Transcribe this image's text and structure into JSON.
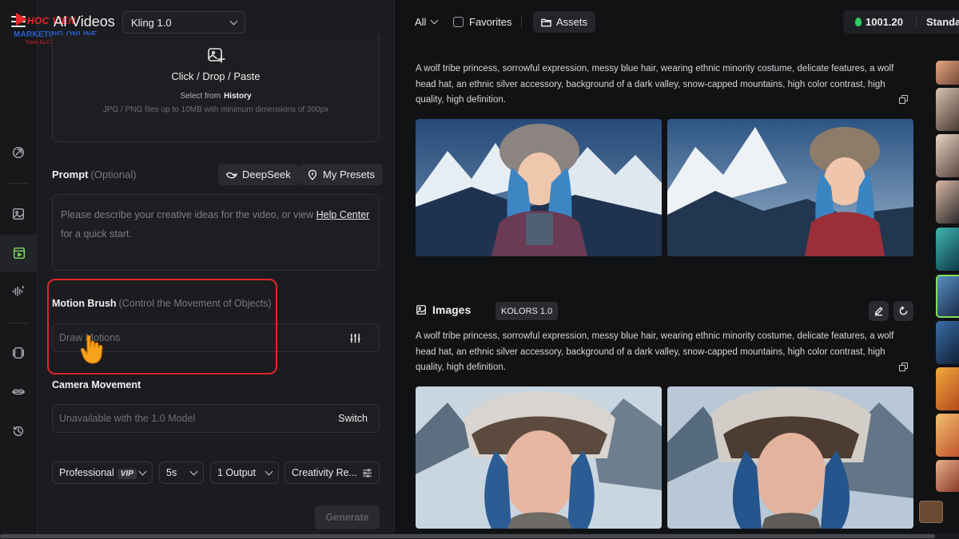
{
  "logo": {
    "line1": "HOC VIEN",
    "line2": "MARKETING ONLINE",
    "line3": "Vươn Xa Cùng Bạn"
  },
  "header": {
    "title": "AI Videos",
    "model_select": "Kling 1.0"
  },
  "upload": {
    "title": "Click / Drop / Paste",
    "select_from": "Select from",
    "history_link": "History",
    "note": "JPG / PNG files up to 10MB with minimum dimensions of 300px"
  },
  "prompt": {
    "label": "Prompt",
    "optional": "(Optional)",
    "deepseek_button": "DeepSeek",
    "presets_button": "My Presets",
    "placeholder_before": "Please describe your creative ideas for the video, or view",
    "help_link": "Help Center",
    "placeholder_after": "for a quick start."
  },
  "motion_brush": {
    "label": "Motion Brush",
    "hint": "(Control the Movement of Objects)",
    "input_placeholder": "Draw Motions"
  },
  "camera": {
    "label": "Camera Movement",
    "status": "Unavailable with the 1.0 Model",
    "switch_button": "Switch"
  },
  "options": {
    "mode": "Professional",
    "vip_badge": "VIP",
    "duration": "5s",
    "outputs": "1 Output",
    "creativity": "Creativity Re..."
  },
  "generate_button": "Generate",
  "toolbar": {
    "filter": "All",
    "favorites": "Favorites",
    "assets": "Assets",
    "credits": "1001.20",
    "plan": "Standa"
  },
  "results": [
    {
      "section": "",
      "tag": "",
      "prompt": "A wolf tribe princess, sorrowful expression, messy blue hair, wearing ethnic minority costume, delicate features, a wolf head hat, an ethnic silver accessory, background of a dark valley, snow-capped mountains, high color contrast, high quality, high definition."
    },
    {
      "section": "Images",
      "tag": "KOLORS 1.0",
      "prompt": "A wolf tribe princess, sorrowful expression, messy blue hair, wearing ethnic minority costume, delicate features, a wolf head hat, an ethnic silver accessory, background of a dark valley, snow-capped mountains, high color contrast, high quality, high definition."
    }
  ],
  "colors": {
    "accent_green": "#7ee05a",
    "highlight_red": "#e0262c",
    "credit_green": "#2fcf6a"
  },
  "icons": [
    "menu-icon",
    "image-upload-icon",
    "deepseek-icon",
    "presets-icon",
    "sliders-icon",
    "hand-cursor-icon",
    "folder-icon",
    "edit-icon",
    "refresh-icon",
    "copy-icon"
  ]
}
